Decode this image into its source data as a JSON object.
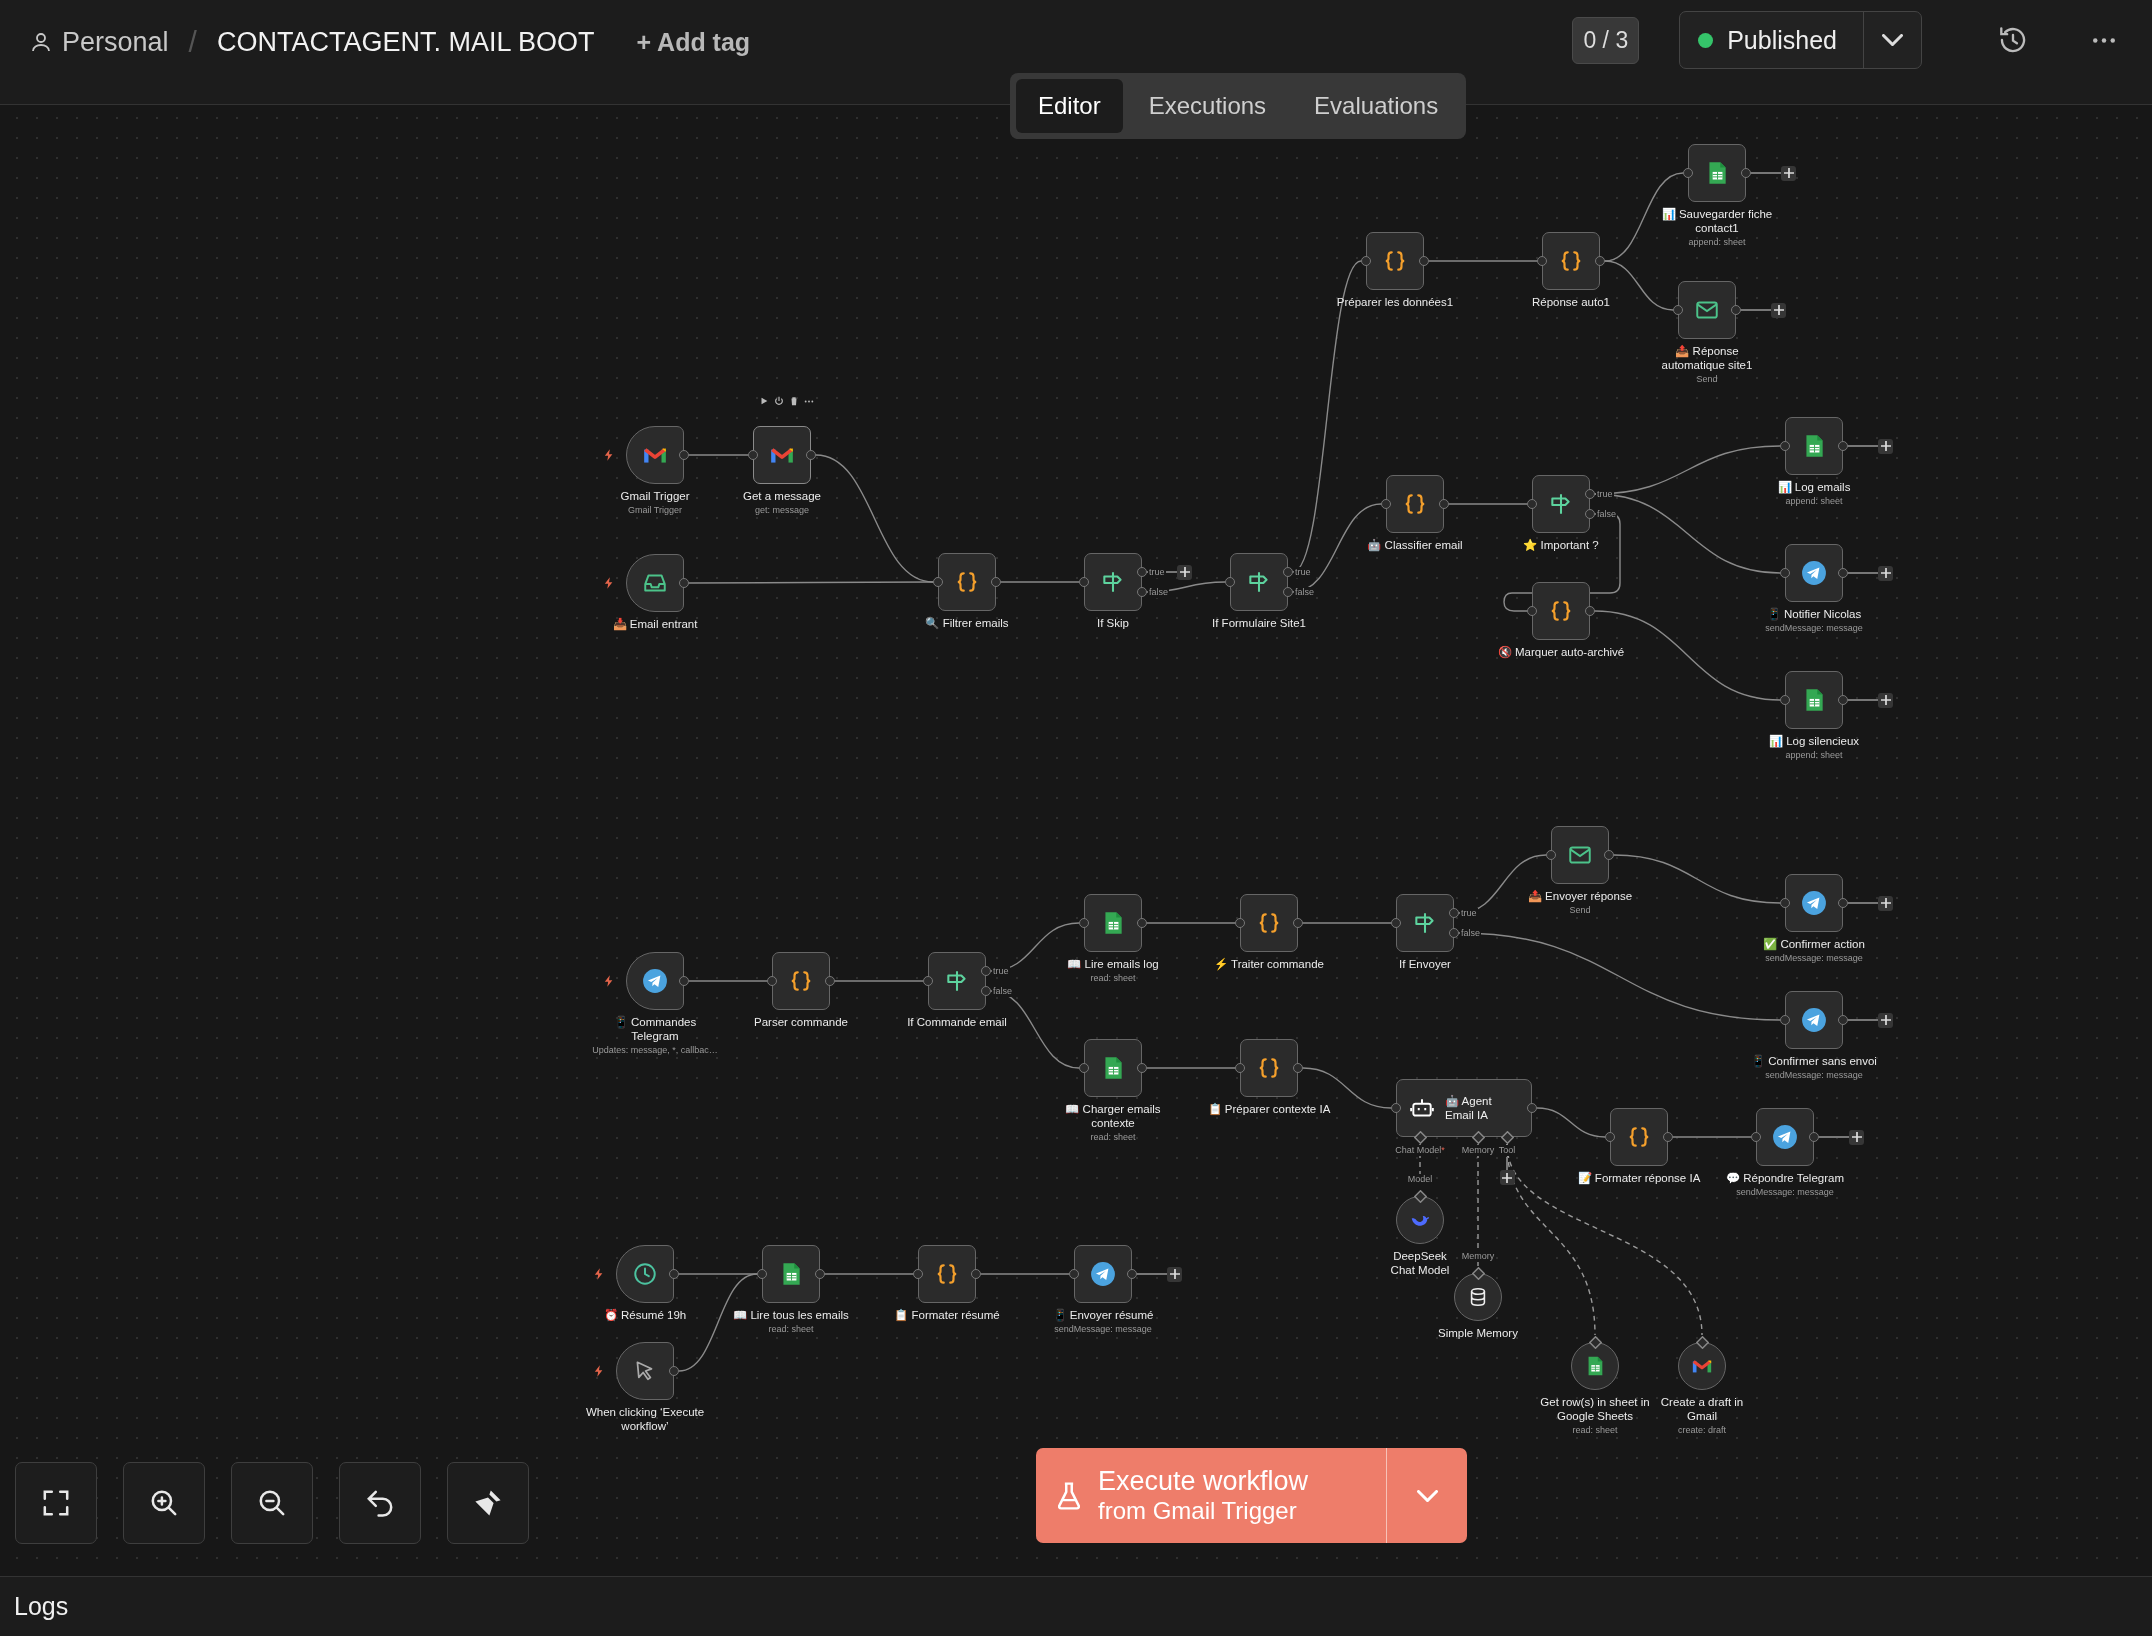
{
  "breadcrumb": {
    "project": "Personal",
    "separator": "/",
    "workflow": "CONTACTAGENT. MAIL BOOT",
    "add_tag": "+ Add tag"
  },
  "view_tabs": [
    {
      "label": "Editor",
      "selected": true
    },
    {
      "label": "Executions",
      "selected": false
    },
    {
      "label": "Evaluations",
      "selected": false
    }
  ],
  "counter": "0 / 3",
  "publish": {
    "label": "Published",
    "active": true
  },
  "nodes": [
    {
      "label": "Gmail Trigger",
      "subtitle": "Gmail Trigger",
      "kind": "gmail",
      "trigger": true,
      "add_button": false,
      "hovered": false
    },
    {
      "label": "Get a message",
      "subtitle": "get: message",
      "kind": "gmail",
      "trigger": false,
      "add_button": false,
      "hovered": true
    },
    {
      "label": "📥 Email entrant",
      "kind": "inbox",
      "trigger": true,
      "add_button": false,
      "hovered": false
    },
    {
      "label": "🔍 Filtrer emails",
      "kind": "code",
      "trigger": false,
      "add_button": false,
      "hovered": false
    },
    {
      "label": "If Skip",
      "kind": "if",
      "trigger": false,
      "add_button": true,
      "hovered": false,
      "outputs": [
        {
          "label": "true"
        },
        {
          "label": "false"
        }
      ]
    },
    {
      "label": "If Formulaire Site1",
      "kind": "if",
      "trigger": false,
      "add_button": false,
      "hovered": false,
      "outputs": [
        {
          "label": "true"
        },
        {
          "label": "false"
        }
      ]
    },
    {
      "label": "Préparer les données1",
      "kind": "code",
      "trigger": false,
      "add_button": false,
      "hovered": false
    },
    {
      "label": "Réponse auto1",
      "kind": "code",
      "trigger": false,
      "add_button": false,
      "hovered": false
    },
    {
      "label": "📊 Sauvegarder fiche contact1",
      "subtitle": "append: sheet",
      "kind": "sheets",
      "trigger": false,
      "add_button": true,
      "hovered": false
    },
    {
      "label": "📤 Réponse automatique site1",
      "subtitle": "Send",
      "kind": "email",
      "trigger": false,
      "add_button": true,
      "hovered": false
    },
    {
      "label": "🤖 Classifier email",
      "kind": "code",
      "trigger": false,
      "add_button": false,
      "hovered": false
    },
    {
      "label": "⭐ Important ?",
      "kind": "if",
      "trigger": false,
      "add_button": false,
      "hovered": false,
      "outputs": [
        {
          "label": "true"
        },
        {
          "label": "false"
        }
      ]
    },
    {
      "label": "🔇 Marquer auto-archivé",
      "kind": "code",
      "trigger": false,
      "add_button": false,
      "hovered": false
    },
    {
      "label": "📊 Log emails",
      "subtitle": "append: sheet",
      "kind": "sheets",
      "trigger": false,
      "add_button": true,
      "hovered": false
    },
    {
      "label": "📱 Notifier Nicolas",
      "subtitle": "sendMessage: message",
      "kind": "telegram",
      "trigger": false,
      "add_button": true,
      "hovered": false
    },
    {
      "label": "📊 Log silencieux",
      "subtitle": "append: sheet",
      "kind": "sheets",
      "trigger": false,
      "add_button": true,
      "hovered": false
    },
    {
      "label": "📱 Commandes Telegram",
      "subtitle": "Updates: message, *, callbac…",
      "kind": "telegram",
      "trigger": true,
      "add_button": false,
      "hovered": false
    },
    {
      "label": "Parser commande",
      "kind": "code",
      "trigger": false,
      "add_button": false,
      "hovered": false
    },
    {
      "label": "If Commande email",
      "kind": "if",
      "trigger": false,
      "add_button": false,
      "hovered": false,
      "outputs": [
        {
          "label": "true"
        },
        {
          "label": "false"
        }
      ]
    },
    {
      "label": "📖 Lire emails log",
      "subtitle": "read: sheet",
      "kind": "sheets",
      "trigger": false,
      "add_button": false,
      "hovered": false
    },
    {
      "label": "⚡ Traiter commande",
      "kind": "code",
      "trigger": false,
      "add_button": false,
      "hovered": false
    },
    {
      "label": "If Envoyer",
      "kind": "if",
      "trigger": false,
      "add_button": false,
      "hovered": false,
      "outputs": [
        {
          "label": "true"
        },
        {
          "label": "false"
        }
      ]
    },
    {
      "label": "📤 Envoyer réponse",
      "subtitle": "Send",
      "kind": "email",
      "trigger": false,
      "add_button": false,
      "hovered": false
    },
    {
      "label": "✅ Confirmer action",
      "subtitle": "sendMessage: message",
      "kind": "telegram",
      "trigger": false,
      "add_button": true,
      "hovered": false
    },
    {
      "label": "📱 Confirmer sans envoi",
      "subtitle": "sendMessage: message",
      "kind": "telegram",
      "trigger": false,
      "add_button": true,
      "hovered": false
    },
    {
      "label": "📖 Charger emails contexte",
      "subtitle": "read: sheet",
      "kind": "sheets",
      "trigger": false,
      "add_button": false,
      "hovered": false
    },
    {
      "label": "📋 Préparer contexte IA",
      "kind": "code",
      "trigger": false,
      "add_button": false,
      "hovered": false
    },
    {
      "label": "🤖 Agent Email IA",
      "kind": "agent",
      "trigger": false,
      "add_button": true,
      "hovered": false,
      "inputs": [
        {
          "label": "Chat Model",
          "required_mark": "*"
        },
        {
          "label": "Memory"
        },
        {
          "label": "Tool"
        }
      ],
      "sub_nodes": [
        {
          "label": "DeepSeek Chat Model",
          "port_label": "Model",
          "kind": "deepseek"
        },
        {
          "label": "Simple Memory",
          "port_label": "Memory",
          "kind": "memory"
        },
        {
          "label": "Get row(s) in sheet in Google Sheets",
          "subtitle": "read: sheet",
          "kind": "sheets-tool"
        },
        {
          "label": "Create a draft in Gmail",
          "subtitle": "create: draft",
          "kind": "gmail-tool"
        }
      ]
    },
    {
      "label": "📝 Formater réponse IA",
      "kind": "code",
      "trigger": false,
      "add_button": false,
      "hovered": false
    },
    {
      "label": "💬 Répondre Telegram",
      "subtitle": "sendMessage: message",
      "kind": "telegram",
      "trigger": false,
      "add_button": true,
      "hovered": false
    },
    {
      "label": "⏰ Résumé 19h",
      "kind": "schedule",
      "trigger": true,
      "add_button": false,
      "hovered": false
    },
    {
      "label": "📖 Lire tous les emails",
      "subtitle": "read: sheet",
      "kind": "sheets",
      "trigger": false,
      "add_button": false,
      "hovered": false
    },
    {
      "label": "📋 Formater résumé",
      "kind": "code",
      "trigger": false,
      "add_button": false,
      "hovered": false
    },
    {
      "label": "📱 Envoyer résumé",
      "subtitle": "sendMessage: message",
      "kind": "telegram",
      "trigger": false,
      "add_button": true,
      "hovered": false
    },
    {
      "label": "When clicking ‘Execute workflow’",
      "kind": "manual",
      "trigger": true,
      "add_button": false,
      "hovered": false
    }
  ],
  "execute_button": {
    "title": "Execute workflow",
    "subtitle": "from Gmail Trigger"
  },
  "logs": {
    "label": "Logs"
  }
}
